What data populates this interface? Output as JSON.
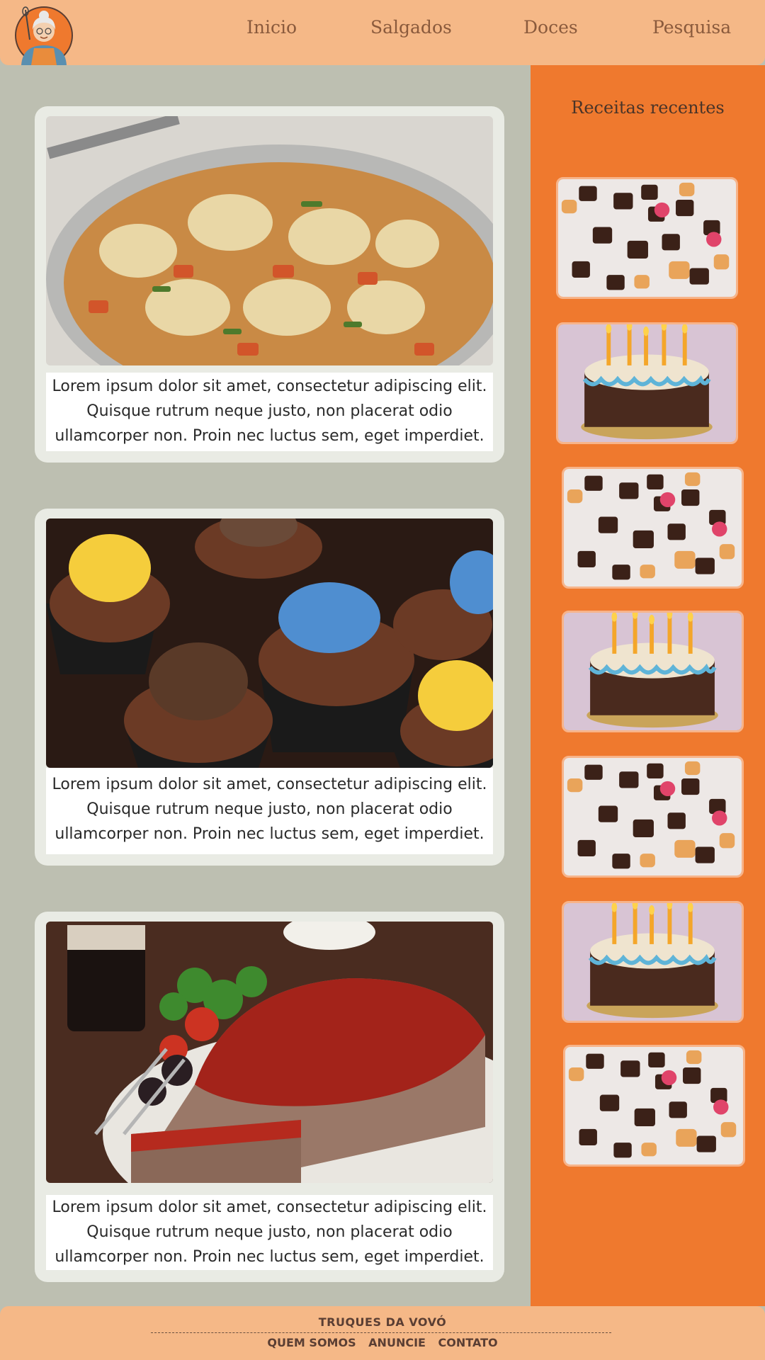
{
  "header": {
    "nav": [
      "Inicio",
      "Salgados",
      "Doces",
      "Pesquisa"
    ]
  },
  "sidebar": {
    "title": "Receitas recentes",
    "thumbnails": [
      "chocolates-thumbnail",
      "birthday-cake-thumbnail",
      "chocolates-thumbnail",
      "birthday-cake-thumbnail",
      "chocolates-thumbnail",
      "birthday-cake-thumbnail",
      "chocolates-thumbnail"
    ]
  },
  "posts": [
    {
      "image": "chicken-rice-casserole-photo",
      "text": "Lorem ipsum dolor sit amet, consectetur adipiscing elit. Quisque rutrum neque justo, non placerat odio ullamcorper non. Proin nec luctus sem, eget imperdiet."
    },
    {
      "image": "chocolate-cupcakes-photo",
      "text": "Lorem ipsum dolor sit amet, consectetur adipiscing elit. Quisque rutrum neque justo, non placerat odio ullamcorper non. Proin nec luctus sem, eget imperdiet."
    },
    {
      "image": "meatloaf-photo",
      "text": "Lorem ipsum dolor sit amet, consectetur adipiscing elit. Quisque rutrum neque justo, non placerat odio ullamcorper non. Proin nec luctus sem, eget imperdiet."
    }
  ],
  "footer": {
    "brand": "TRUQUES DA VOVÓ",
    "links": [
      "QUEM SOMOS",
      "ANUNCIE",
      "CONTATO"
    ]
  },
  "colors": {
    "header_bg": "#f5b887",
    "sidebar_bg": "#ef792e",
    "page_bg": "#bdbfb1",
    "card_bg": "#e9ebe4",
    "text_brown": "#8a5a3c"
  }
}
